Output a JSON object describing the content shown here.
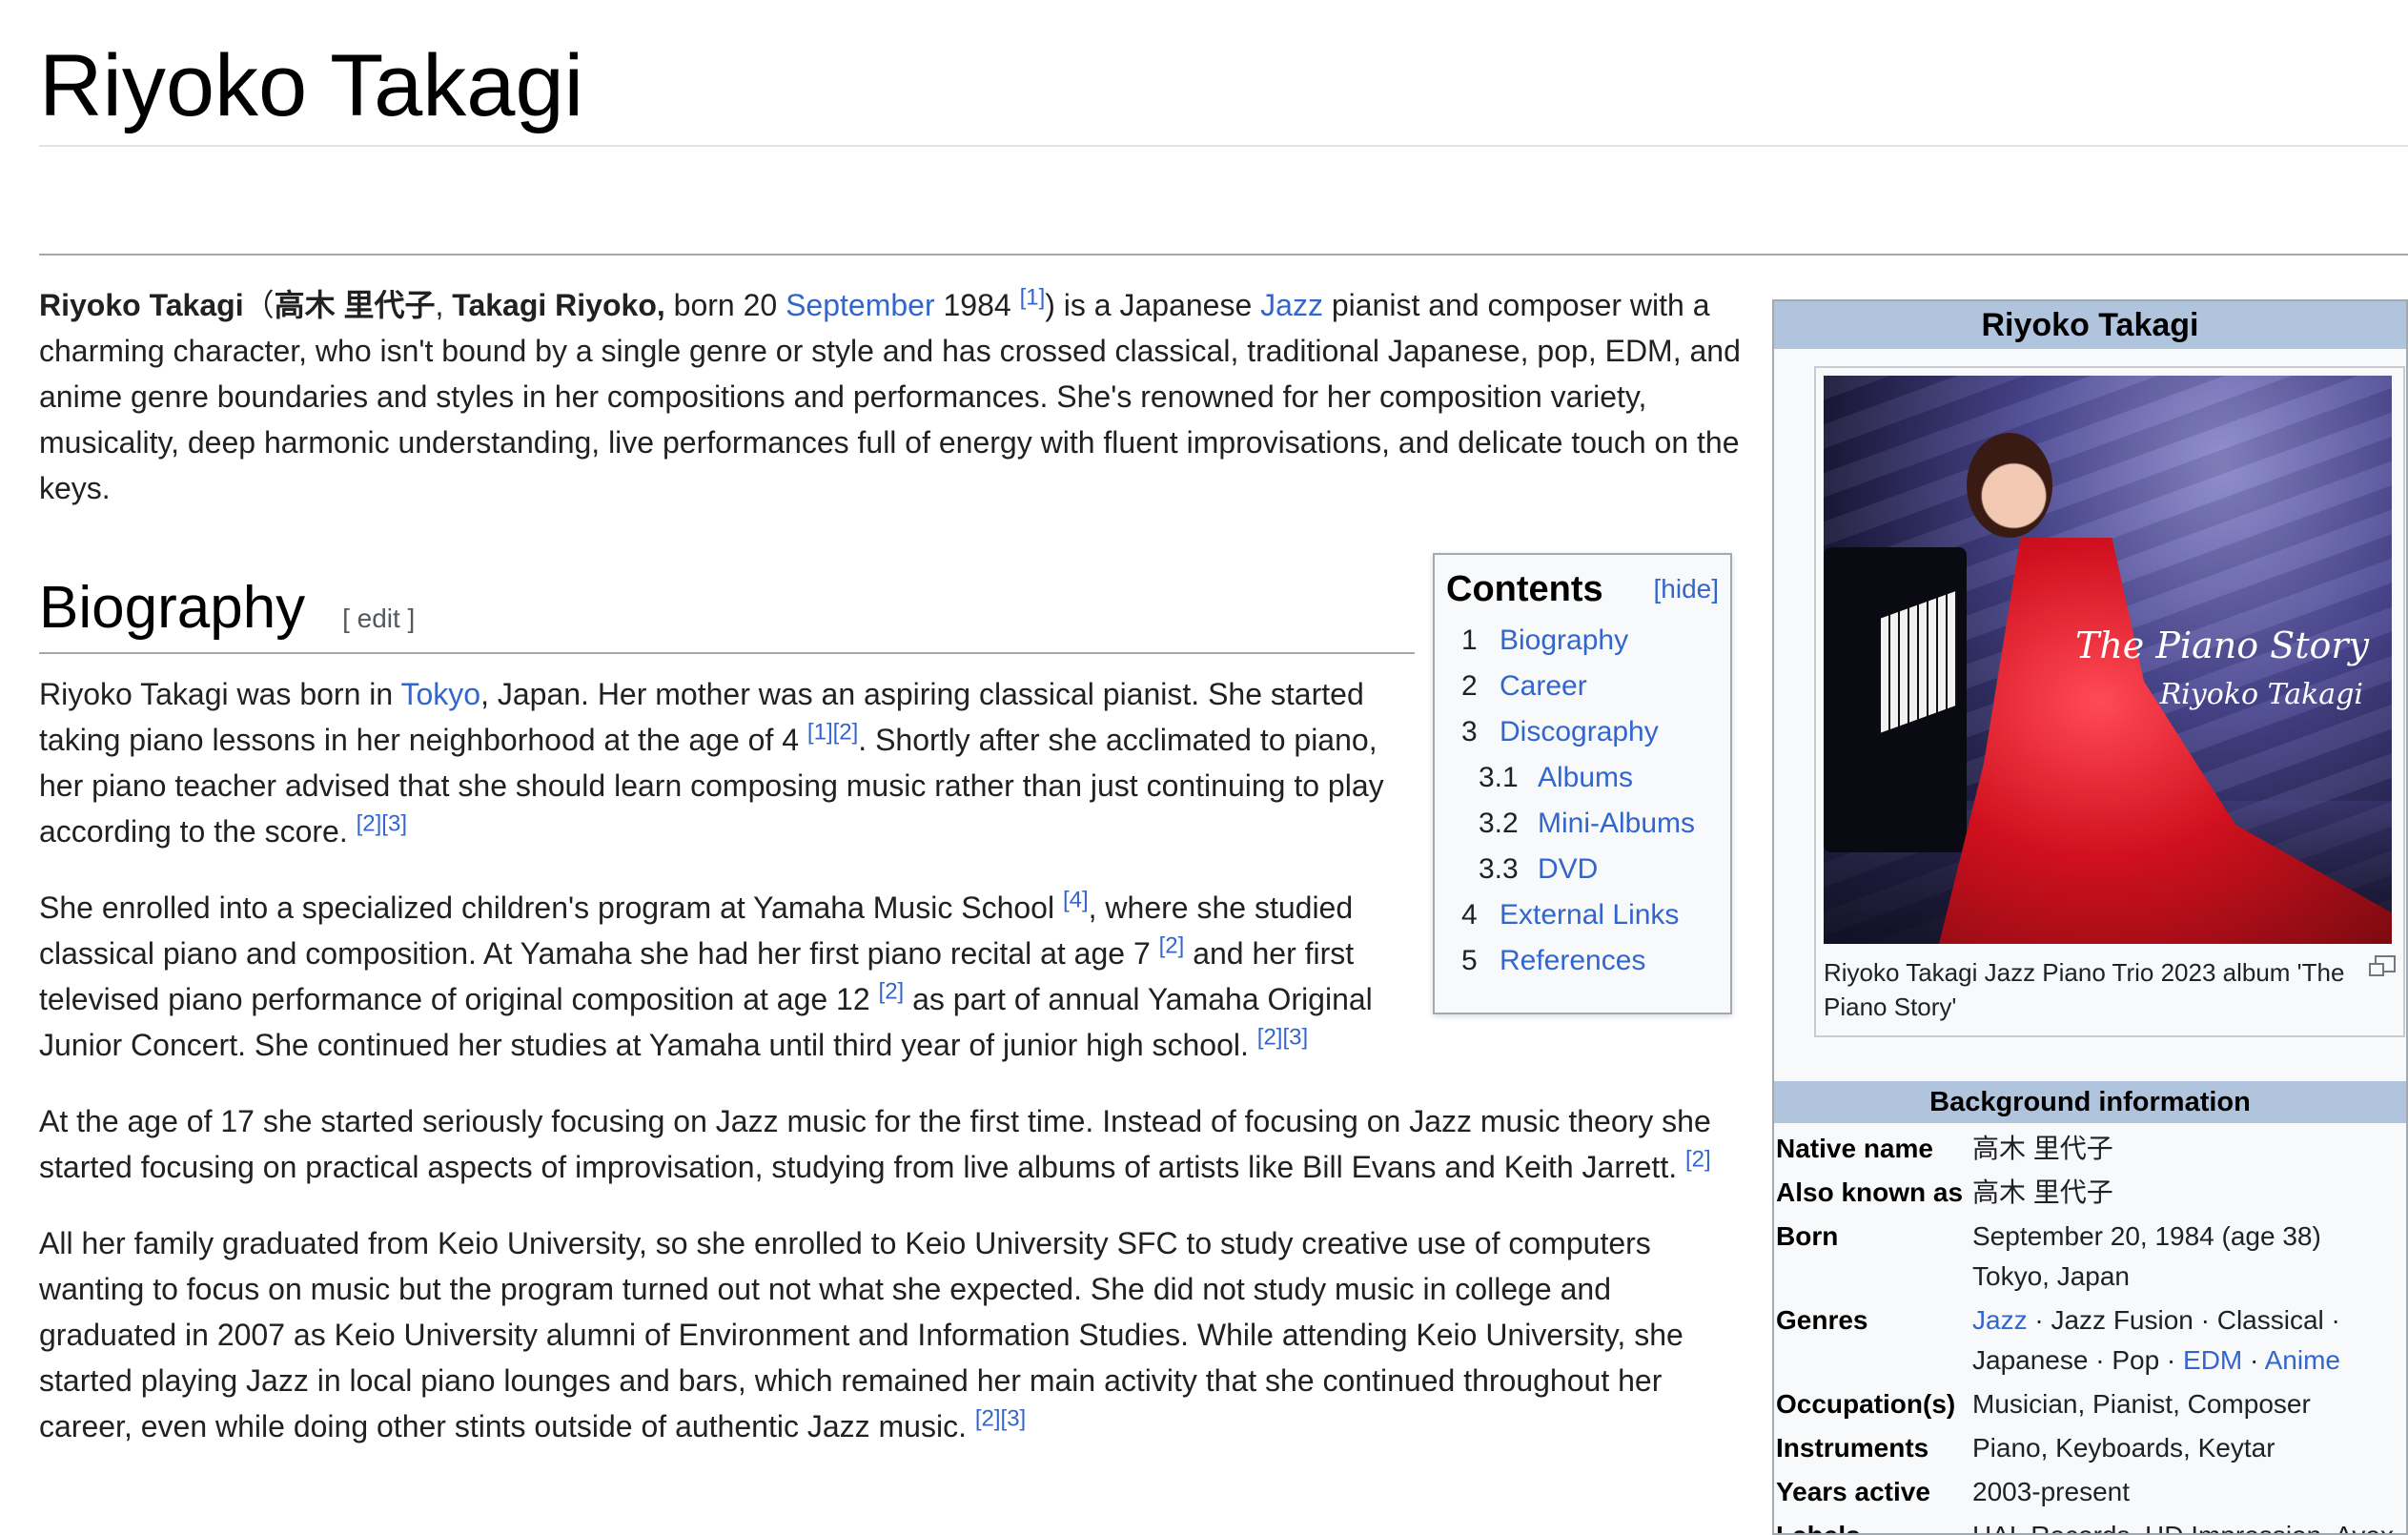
{
  "page": {
    "title": "Riyoko Takagi"
  },
  "lead": {
    "name_bold": "Riyoko Takagi",
    "paren_open": "（",
    "native_bold": "高木 里代子",
    "sep": ", ",
    "romaji_bold": "Takagi Riyoko,",
    "born_text": " born 20 ",
    "month_link": "September",
    "year_text": " 1984 ",
    "ref1": "[1]",
    "rest_1": ") is a Japanese ",
    "jazz_link": "Jazz",
    "rest_2": " pianist and composer with a charming character, who isn't bound by a single genre or style and has crossed classical, traditional Japanese, pop, EDM, and anime genre boundaries and styles in her compositions and performances. She's renowned for her composition variety, musicality, deep harmonic understanding, live performances full of energy with fluent improvisations, and delicate touch on the keys."
  },
  "biography": {
    "heading": "Biography",
    "edit_label": "[ edit ]",
    "p1": {
      "t1": "Riyoko Takagi was born in ",
      "tokyo_link": "Tokyo",
      "t2": ", Japan. Her mother was an aspiring classical pianist. She started taking piano lessons in her neighborhood at the age of 4 ",
      "ref_a": "[1][2]",
      "t3": ". Shortly after she acclimated to piano, her piano teacher advised that she should learn composing music rather than just continuing to play according to the score. ",
      "ref_b": "[2][3]"
    },
    "p2": {
      "t1": "She enrolled into a specialized children's program at Yamaha Music School ",
      "ref_a": "[4]",
      "t2": ", where she studied classical piano and composition. At Yamaha she had her first piano recital at age 7 ",
      "ref_b": "[2]",
      "t3": " and her first televised piano performance of original composition at age 12 ",
      "ref_c": "[2]",
      "t4": " as part of annual Yamaha Original Junior Concert. She continued her studies at Yamaha until third year of junior high school. ",
      "ref_d": "[2][3]"
    },
    "p3": {
      "t1": "At the age of 17 she started seriously focusing on Jazz music for the first time. Instead of focusing on Jazz music theory she started focusing on practical aspects of improvisation, studying from live albums of artists like Bill Evans and Keith Jarrett. ",
      "ref_a": "[2]"
    },
    "p4": {
      "t1": "All her family graduated from Keio University, so she enrolled to Keio University SFC to study creative use of computers wanting to focus on music but the program turned out not what she expected. She did not study music in college and graduated in 2007 as Keio University alumni of Environment and Information Studies. While attending Keio University, she started playing Jazz in local piano lounges and bars, which remained her main activity that she continued throughout her career, even while doing other stints outside of authentic Jazz music. ",
      "ref_a": "[2][3]"
    }
  },
  "toc": {
    "title": "Contents",
    "hide_label": "[hide]",
    "items": [
      {
        "num": "1",
        "label": "Biography"
      },
      {
        "num": "2",
        "label": "Career"
      },
      {
        "num": "3",
        "label": "Discography"
      },
      {
        "num": "3.1",
        "label": "Albums"
      },
      {
        "num": "3.2",
        "label": "Mini-Albums"
      },
      {
        "num": "3.3",
        "label": "DVD"
      },
      {
        "num": "4",
        "label": "External Links"
      },
      {
        "num": "5",
        "label": "References"
      }
    ]
  },
  "infobox": {
    "title": "Riyoko Takagi",
    "cover_title": "The Piano Story",
    "cover_artist": "Riyoko Takagi",
    "caption": "Riyoko Takagi Jazz Piano Trio 2023 album 'The Piano Story'",
    "section": "Background information",
    "rows": {
      "native_name": {
        "label": "Native name",
        "value": "高木 里代子"
      },
      "also_known": {
        "label": "Also known as",
        "value": "高木 里代子"
      },
      "born": {
        "label": "Born",
        "value1": "September 20, 1984 (age 38)",
        "value2": "Tokyo, Japan"
      },
      "genres": {
        "label": "Genres",
        "g1": "Jazz",
        "g2": " · Jazz Fusion · Classical · Japanese · Pop · ",
        "g3": "EDM",
        "g4": " · ",
        "g5": "Anime"
      },
      "occupation": {
        "label": "Occupation(s)",
        "value": "Musician, Pianist, Composer"
      },
      "instruments": {
        "label": "Instruments",
        "value": "Piano, Keyboards, Keytar"
      },
      "years_active": {
        "label": "Years active",
        "value": "2003-present"
      },
      "labels": {
        "label": "Labels",
        "value": "HAL Records, HD Impression, Avex"
      }
    }
  }
}
